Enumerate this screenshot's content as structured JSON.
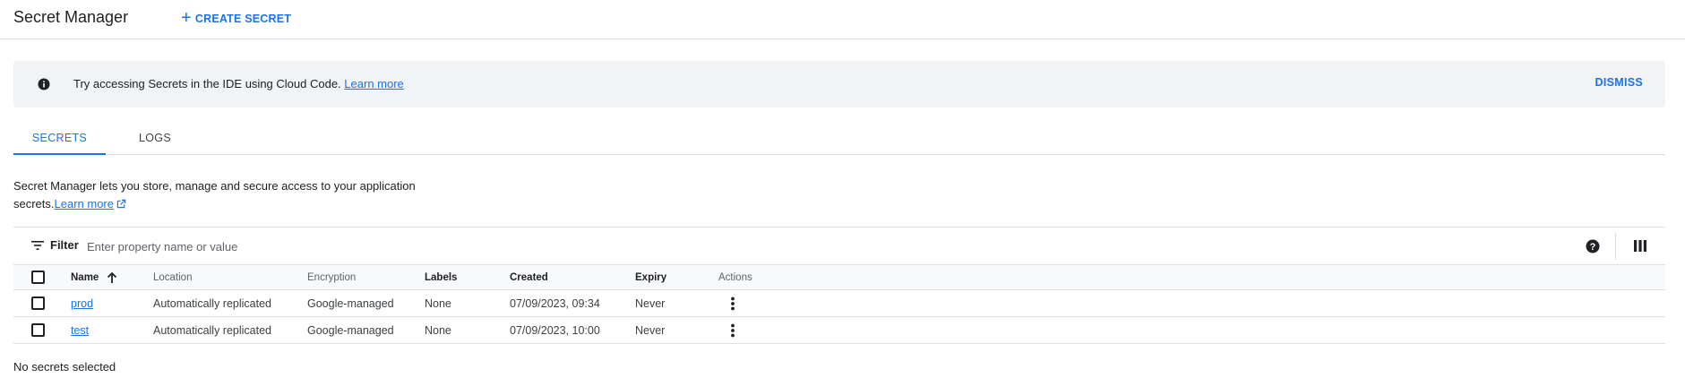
{
  "header": {
    "title": "Secret Manager",
    "create_label": "CREATE SECRET"
  },
  "banner": {
    "icon": "info-icon",
    "message": "Try accessing Secrets in the IDE using Cloud Code.",
    "link_label": "Learn more",
    "dismiss_label": "DISMISS"
  },
  "tabs": [
    {
      "label": "SECRETS",
      "active": true
    },
    {
      "label": "LOGS",
      "active": false
    }
  ],
  "description": {
    "text_line1": "Secret Manager lets you store, manage and secure access to your application",
    "text_line2": "secrets.",
    "link_label": "Learn more",
    "link_icon": "external-link-icon"
  },
  "filter": {
    "label": "Filter",
    "placeholder": "Enter property name or value",
    "icons": [
      "filter-icon",
      "help-icon",
      "column-display-icon"
    ]
  },
  "table": {
    "columns": [
      "Name",
      "Location",
      "Encryption",
      "Labels",
      "Created",
      "Expiry",
      "Actions"
    ],
    "sort": {
      "column": "Name",
      "direction": "ascending",
      "icon": "arrow-up-icon"
    },
    "rows": [
      {
        "name": "prod",
        "location": "Automatically replicated",
        "encryption": "Google-managed",
        "labels": "None",
        "created": "07/09/2023, 09:34",
        "expiry": "Never"
      },
      {
        "name": "test",
        "location": "Automatically replicated",
        "encryption": "Google-managed",
        "labels": "None",
        "created": "07/09/2023, 10:00",
        "expiry": "Never"
      }
    ]
  },
  "selection_status": "No secrets selected",
  "colors": {
    "accent": "#1a73e8",
    "banner_bg": "#f1f3f4",
    "divider": "#dadce0",
    "text": "#202124"
  }
}
